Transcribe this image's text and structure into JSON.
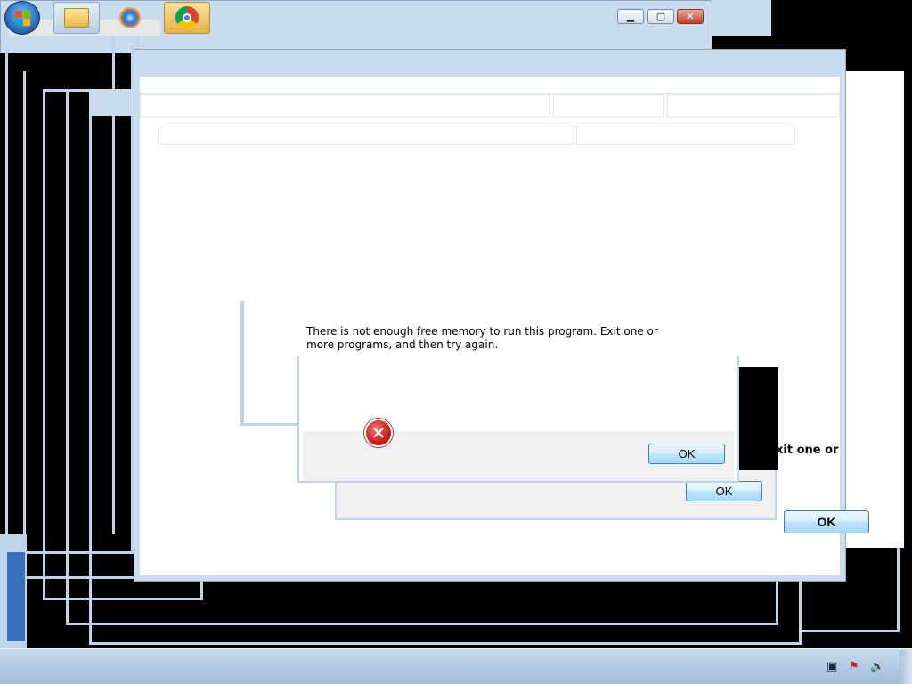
{
  "background_windows": {
    "title_buttons": {
      "minimize_glyph": "▁",
      "maximize_glyph": "▢",
      "close_glyph": "✕"
    }
  },
  "dialogs": [
    {
      "message": "There is not enough free memory to run this program. Exit one or more programs, and then try again.",
      "ok_label": "OK"
    },
    {
      "ok_label": "OK"
    },
    {
      "ok_label": "OK"
    }
  ],
  "ghost_text": "xit one or",
  "icons": {
    "error": "error-icon",
    "start": "windows-start-icon",
    "explorer": "folder-icon",
    "media_player": "media-player-icon",
    "chrome": "chrome-icon"
  },
  "taskbar": {
    "tray": [
      "network-icon",
      "action-center-icon",
      "volume-icon"
    ]
  },
  "colors": {
    "accent_blue": "#3c7fb1",
    "error_red": "#d32020",
    "frame": "#bfd4ea"
  }
}
